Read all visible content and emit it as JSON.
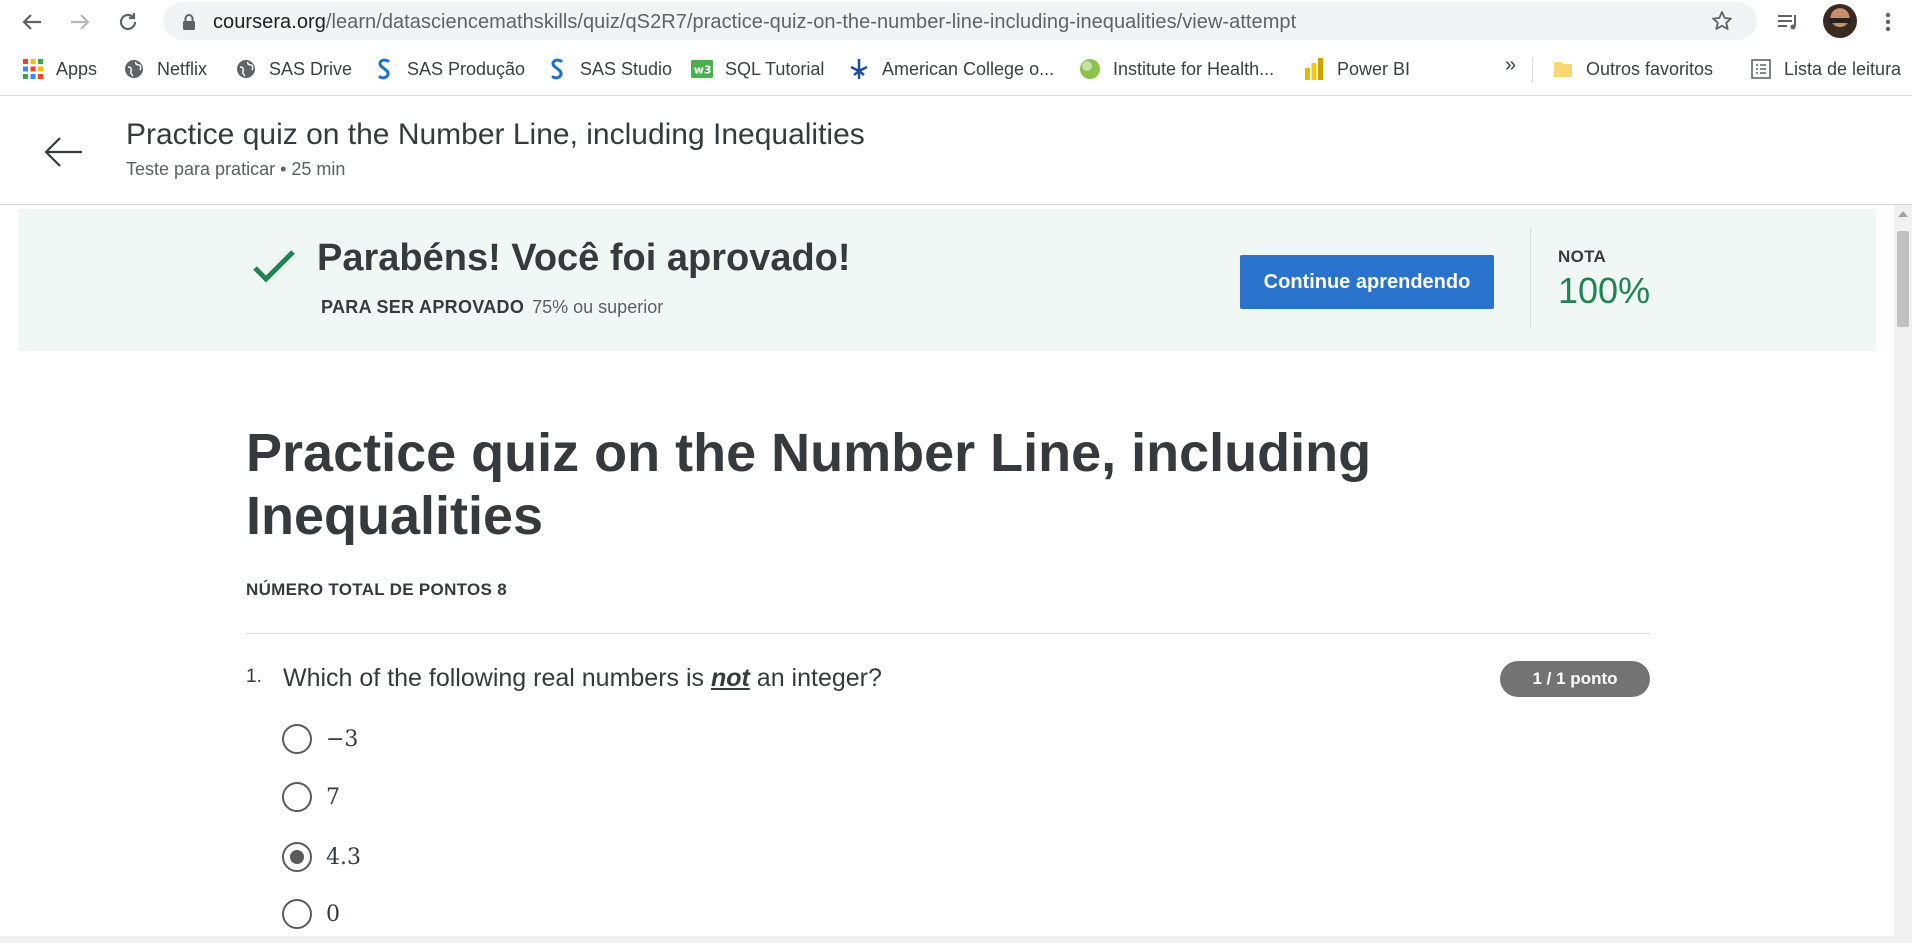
{
  "browser": {
    "url_domain": "coursera.org",
    "url_path": "/learn/datasciencemathskills/quiz/qS2R7/practice-quiz-on-the-number-line-including-inequalities/view-attempt"
  },
  "bookmarks": {
    "items": [
      {
        "label": "Apps",
        "icon": "apps-grid-icon"
      },
      {
        "label": "Netflix",
        "icon": "globe-icon"
      },
      {
        "label": "SAS Drive",
        "icon": "globe-icon"
      },
      {
        "label": "SAS Produção",
        "icon": "sas-icon"
      },
      {
        "label": "SAS Studio",
        "icon": "sas-icon"
      },
      {
        "label": "SQL Tutorial",
        "icon": "w3-icon"
      },
      {
        "label": "American College o...",
        "icon": "acsm-icon"
      },
      {
        "label": "Institute for Health...",
        "icon": "ihme-icon"
      },
      {
        "label": "Power BI",
        "icon": "powerbi-icon"
      }
    ],
    "more": "»",
    "other_favorites": "Outros favoritos",
    "reading_list": "Lista de leitura"
  },
  "header": {
    "title": "Practice quiz on the Number Line, including Inequalities",
    "subtitle": "Teste para praticar • 25 min"
  },
  "result": {
    "title": "Parabéns! Você foi aprovado!",
    "pass_label": "PARA SER APROVADO",
    "pass_value": "75% ou superior",
    "continue_label": "Continue aprendendo",
    "grade_label": "NOTA",
    "grade_value": "100%"
  },
  "quiz": {
    "title": "Practice quiz on the Number Line, including Inequalities",
    "total_points_label": "NÚMERO TOTAL DE PONTOS",
    "total_points_value": "8",
    "question": {
      "number": "1.",
      "text_before": "Which of the following real numbers is ",
      "text_emphasis": "not",
      "text_after": " an integer?",
      "points": "1 / 1 ponto",
      "options": [
        {
          "label": "−3",
          "selected": false
        },
        {
          "label": "7",
          "selected": false
        },
        {
          "label": "4.3",
          "selected": true
        },
        {
          "label": "0",
          "selected": false
        }
      ]
    }
  },
  "colors": {
    "accent_blue": "#2a73cc",
    "success_green": "#1f8354",
    "banner_bg": "#f1f7f5"
  }
}
